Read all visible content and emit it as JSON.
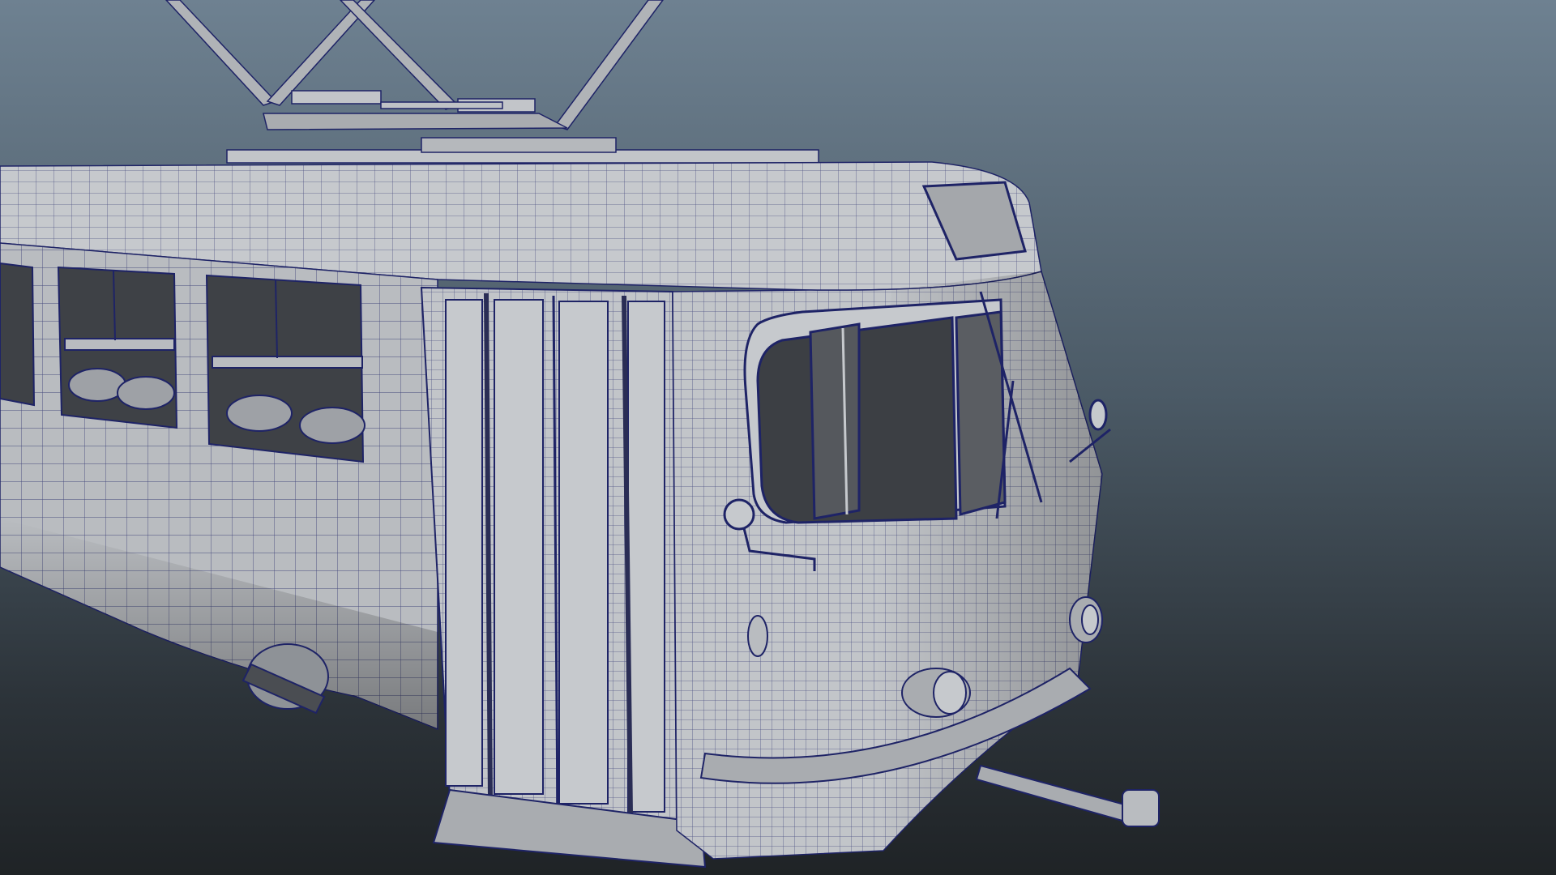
{
  "viewport": {
    "background_top": "#6e8191",
    "background_bottom": "#1f2326"
  },
  "model": {
    "body_color": "#b9bcc0",
    "shade_color": "#8e9297",
    "dark_color": "#4a4d52",
    "wire_color": "#1e2366",
    "glass_color": "#3c3f44"
  }
}
